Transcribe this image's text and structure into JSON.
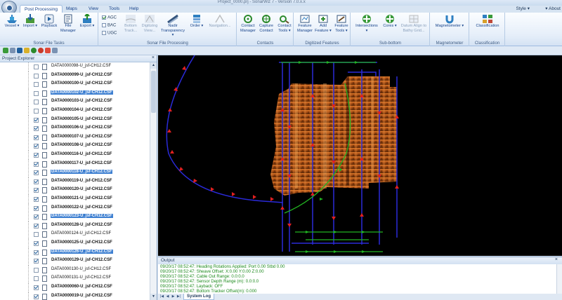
{
  "window": {
    "title": "Project_0000.prj - SonarWiz 7 - Version 7.0.x.x"
  },
  "tabs": [
    "Post Processing",
    "Maps",
    "View",
    "Tools",
    "Help"
  ],
  "topright": {
    "style": "Style ▾",
    "about": "▾ About"
  },
  "ribbon": {
    "file_tasks": {
      "label": "Sonar File Tasks",
      "vessel": "Vessel ▾",
      "import": "Import ▾",
      "playback": "Playback",
      "file_manager": "File Manager",
      "export": "Export ▾"
    },
    "agc": {
      "agc": "AGC",
      "bac": "BAC",
      "ugc": "UGC"
    },
    "processing": {
      "label": "Sonar File Processing",
      "bottom_track": "Bottom Track...",
      "digitizing_view": "Digitizing View...",
      "nadir_transparency": "Nadir Transparency ▾",
      "order": "Order ▾",
      "navigation": "Navigation..."
    },
    "contacts": {
      "label": "Contacts",
      "manager": "Contact Manager",
      "capture": "Capture Contact",
      "tools": "Contact Tools ▾"
    },
    "features": {
      "label": "Digitized Features",
      "manager": "Feature Manager",
      "add": "Add Feature ▾",
      "tools": "Feature Tools ▾"
    },
    "subbottom": {
      "label": "Sub-bottom",
      "intersections": "Intersections ▾",
      "cores": "Cores ▾",
      "datum_align": "Datum Align to Bathy Grid..."
    },
    "magnetometer": {
      "label": "Magnetometer",
      "btn": "Magnetometer ▾"
    },
    "classification": {
      "label": "Classification",
      "btn": "Classification"
    }
  },
  "explorer": {
    "title": "Project Explorer",
    "files": [
      {
        "name": "DATA0000098-U_jsf-CH12.CSF",
        "checked": false,
        "selected": false,
        "bold": false
      },
      {
        "name": "DATA0000099-U_jsf-CH12.CSF",
        "checked": false,
        "selected": false,
        "bold": true
      },
      {
        "name": "DATA0000100-U_jsf-CH12.CSF",
        "checked": false,
        "selected": false,
        "bold": true
      },
      {
        "name": "DATA0000102-U_jsf-CH12.CSF",
        "checked": false,
        "selected": true,
        "bold": true
      },
      {
        "name": "DATA0000103-U_jsf-CH12.CSF",
        "checked": false,
        "selected": false,
        "bold": true
      },
      {
        "name": "DATA0000104-U_jsf-CH12.CSF",
        "checked": false,
        "selected": false,
        "bold": true
      },
      {
        "name": "DATA0000105-U_jsf-CH12.CSF",
        "checked": true,
        "selected": false,
        "bold": true
      },
      {
        "name": "DATA0000106-U_jsf-CH12.CSF",
        "checked": true,
        "selected": false,
        "bold": true
      },
      {
        "name": "DATA0000107-U_jsf-CH12.CSF",
        "checked": true,
        "selected": false,
        "bold": true
      },
      {
        "name": "DATA0000108-U_jsf-CH12.CSF",
        "checked": true,
        "selected": false,
        "bold": true
      },
      {
        "name": "DATA0000116-U_jsf-CH12.CSF",
        "checked": true,
        "selected": false,
        "bold": true
      },
      {
        "name": "DATA0000117-U_jsf-CH12.CSF",
        "checked": true,
        "selected": false,
        "bold": true
      },
      {
        "name": "DATA0000118-U_jsf-CH12.CSF",
        "checked": true,
        "selected": true,
        "bold": true
      },
      {
        "name": "DATA0000119-U_jsf-CH12.CSF",
        "checked": true,
        "selected": false,
        "bold": true
      },
      {
        "name": "DATA0000120-U_jsf-CH12.CSF",
        "checked": true,
        "selected": false,
        "bold": true
      },
      {
        "name": "DATA0000121-U_jsf-CH12.CSF",
        "checked": true,
        "selected": false,
        "bold": true
      },
      {
        "name": "DATA0000122-U_jsf-CH12.CSF",
        "checked": true,
        "selected": false,
        "bold": true
      },
      {
        "name": "DATA0000123-U_jsf-CH12.CSF",
        "checked": true,
        "selected": true,
        "bold": true
      },
      {
        "name": "DATA0000128-U_jsf-CH12.CSF",
        "checked": true,
        "selected": false,
        "bold": true
      },
      {
        "name": "DATA0000124-U_jsf-CH12.CSF",
        "checked": false,
        "selected": false,
        "bold": false
      },
      {
        "name": "DATA0000125-U_jsf-CH12.CSF",
        "checked": true,
        "selected": false,
        "bold": true
      },
      {
        "name": "DATA0000126-U_jsf-CH12.CSF",
        "checked": true,
        "selected": true,
        "bold": true
      },
      {
        "name": "DATA0000129-U_jsf-CH12.CSF",
        "checked": true,
        "selected": false,
        "bold": true
      },
      {
        "name": "DATA0000130-U_jsf-CH12.CSF",
        "checked": false,
        "selected": false,
        "bold": false
      },
      {
        "name": "DATA0000131-U_jsf-CH12.CSF",
        "checked": false,
        "selected": false,
        "bold": false
      },
      {
        "name": "DATA0000060-U_jsf-CH12.CSF",
        "checked": true,
        "selected": false,
        "bold": true
      },
      {
        "name": "DATA0000019-U_jsf-CH12.CSF",
        "checked": true,
        "selected": false,
        "bold": true
      }
    ]
  },
  "output": {
    "title": "Output",
    "lines": [
      "09/20/17 08:52:47: Heading Rotations Applied: Port 0.00 Stbd 0.00",
      "09/20/17 08:52:47: Sheave Offset: X:0.00 Y:0.00 Z:0.00",
      "09/20/17 08:52:47: Cable Out Range: 0.0:0.0",
      "09/20/17 08:52:47: Sensor Depth Range (m): 0.0:0.0",
      "09/20/17 08:52:47: Layback: OFF",
      "09/20/17 08:52:47: Bottom Tracker Offset(m): 0.000"
    ],
    "tab": "System Log"
  },
  "colors": {
    "track": "#2a2ad8",
    "arrow": "#e02020",
    "green": "#22b422",
    "mosaic": "#c8661e"
  }
}
